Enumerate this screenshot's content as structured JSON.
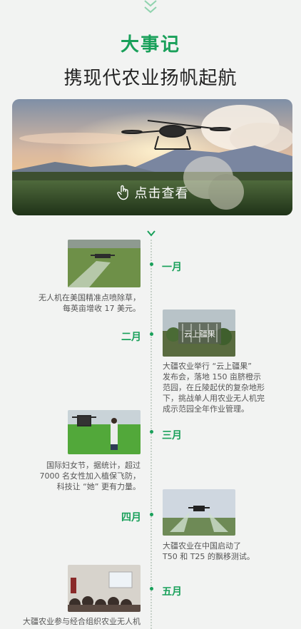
{
  "header": {
    "title": "大事记",
    "subtitle": "携现代农业扬帆起航"
  },
  "hero": {
    "cta_label": "点击查看"
  },
  "colors": {
    "accent": "#19a05a",
    "background": "#f2f3f2"
  },
  "timeline": [
    {
      "month": "一月",
      "text": "无人机在美国精准点喷除草，\n每英亩增收 17 美元。"
    },
    {
      "month": "二月",
      "text": "大疆农业举行 “云上疆果”\n发布会，落地 150 亩脐橙示\n范园，在丘陵起伏的复杂地形\n下，挑战单人用农业无人机完\n成示范园全年作业管理。"
    },
    {
      "month": "三月",
      "text": "国际妇女节，据统计，超过\n7000 名女性加入植保飞防，\n科技让 “她” 更有力量。"
    },
    {
      "month": "四月",
      "text": "大疆农业在中国启动了\nT50 和 T25 的飘移测试。"
    },
    {
      "month": "五月",
      "text": "大疆农业参与经合组织农业无人机"
    }
  ],
  "photo_signs": {
    "feb_sign": "云上疆果"
  }
}
